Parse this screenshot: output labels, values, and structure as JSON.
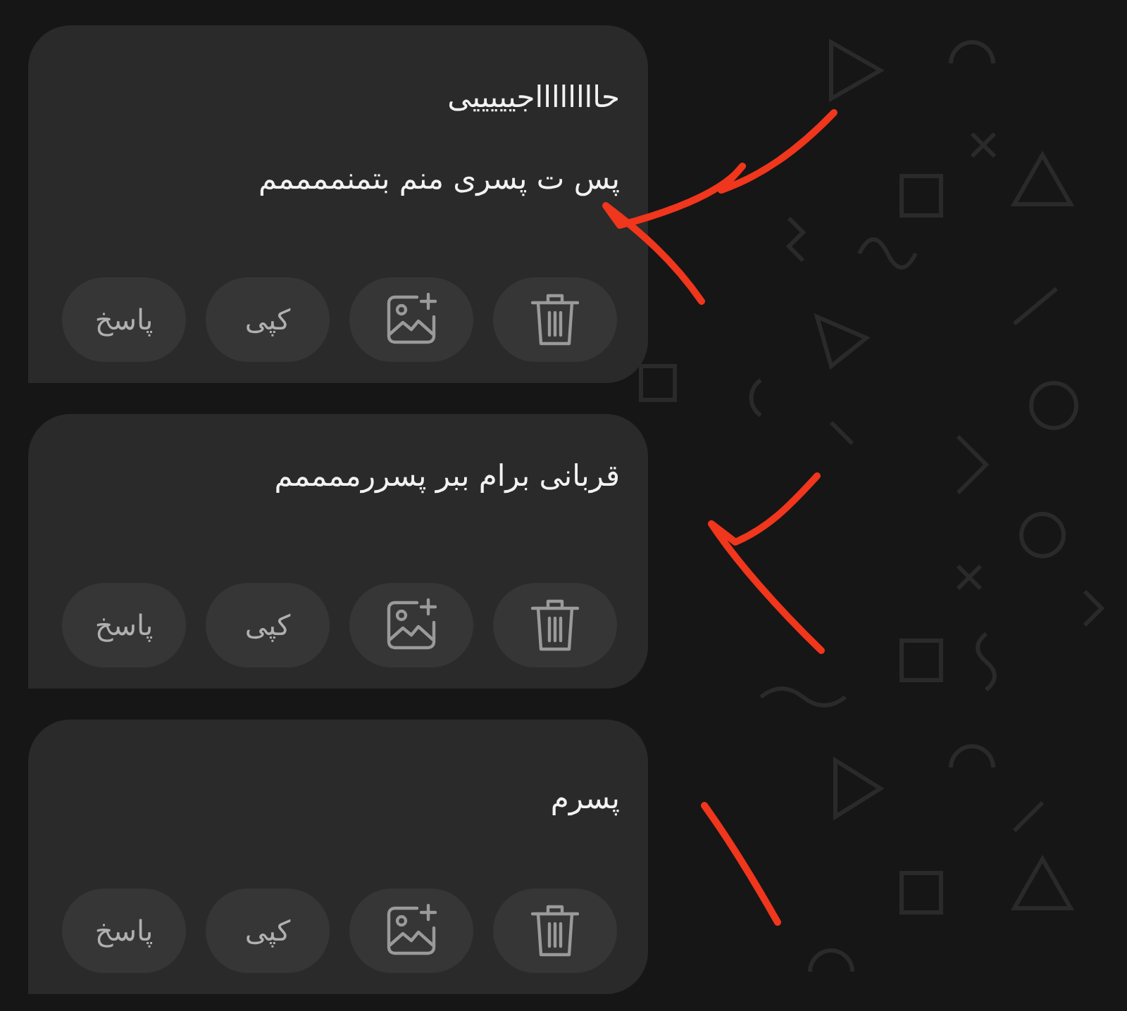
{
  "messages": [
    {
      "lines": [
        "حااااااااجیییییی",
        "پس ت پسری منم بتمنممممم"
      ],
      "actions": [
        {
          "kind": "delete"
        },
        {
          "kind": "add-image"
        },
        {
          "kind": "text",
          "label": "کپی"
        },
        {
          "kind": "text",
          "label": "پاسخ"
        }
      ]
    },
    {
      "lines": [
        "قربانی برام ببر پسررممممم"
      ],
      "actions": [
        {
          "kind": "delete"
        },
        {
          "kind": "add-image"
        },
        {
          "kind": "text",
          "label": "کپی"
        },
        {
          "kind": "text",
          "label": "پاسخ"
        }
      ]
    },
    {
      "lines": [
        "پسرم"
      ],
      "actions": [
        {
          "kind": "delete"
        },
        {
          "kind": "add-image"
        },
        {
          "kind": "text",
          "label": "کپی"
        },
        {
          "kind": "text",
          "label": "پاسخ"
        }
      ]
    }
  ]
}
